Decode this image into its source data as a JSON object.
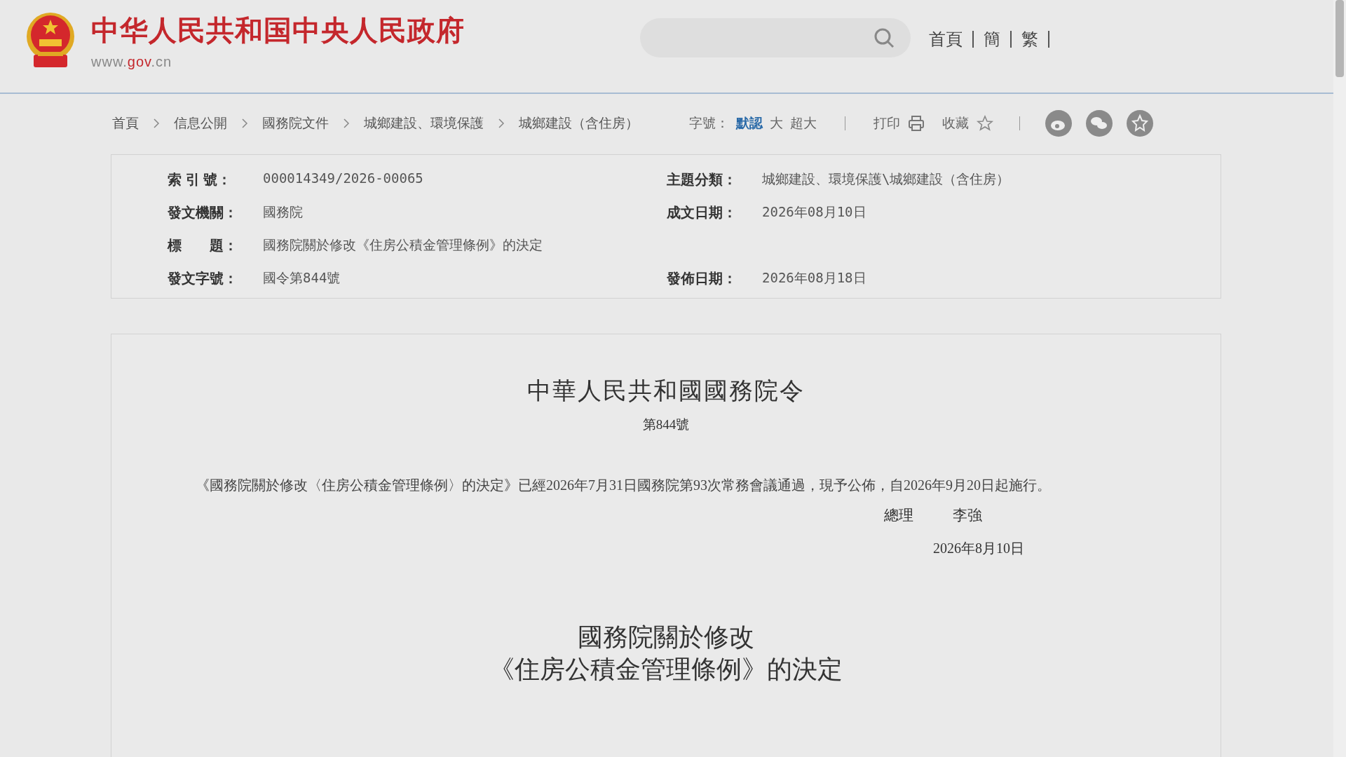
{
  "header": {
    "title": "中华人民共和国中央人民政府",
    "url_prefix": "www.",
    "url_domain": "gov",
    "url_suffix": ".cn",
    "nav": [
      {
        "label": "首頁"
      },
      {
        "label": "簡"
      },
      {
        "label": "繁"
      }
    ]
  },
  "breadcrumb": [
    {
      "label": "首頁",
      "current": false
    },
    {
      "label": "信息公開",
      "current": false
    },
    {
      "label": "國務院文件",
      "current": false
    },
    {
      "label": "城鄉建設、環境保護",
      "current": false
    },
    {
      "label": "城鄉建設（含住房）",
      "current": false
    }
  ],
  "font_size": {
    "label": "字號：",
    "options": [
      {
        "label": "默認",
        "selected": true
      },
      {
        "label": "大",
        "selected": false
      },
      {
        "label": "超大",
        "selected": false
      }
    ]
  },
  "tools": [
    {
      "label": "打印",
      "kind": "print"
    },
    {
      "label": "收藏",
      "kind": "favorite"
    }
  ],
  "info": {
    "rows": [
      {
        "cells": [
          {
            "label": "索 引 號：",
            "value": "000014349/2026-00065"
          },
          {
            "label": "主題分類：",
            "value": "城鄉建設、環境保護\\城鄉建設（含住房）"
          }
        ]
      },
      {
        "cells": [
          {
            "label": "發文機關：",
            "value": "國務院"
          },
          {
            "label": "成文日期：",
            "value": "2026年08月10日"
          }
        ]
      },
      {
        "cells": [
          {
            "label": "標　　題：",
            "value": "國務院關於修改《住房公積金管理條例》的決定"
          }
        ]
      },
      {
        "cells": [
          {
            "label": "發文字號：",
            "value": "國令第844號"
          },
          {
            "label": "發佈日期：",
            "value": "2026年08月18日"
          }
        ]
      }
    ]
  },
  "document": {
    "heading": "中華人民共和國國務院令",
    "number": "第844號",
    "body": "《國務院關於修改〈住房公積金管理條例〉的決定》已經2026年7月31日國務院第93次常務會議通過，現予公佈，自2026年9月20日起施行。",
    "signature": {
      "title": "總理",
      "name": "李強"
    },
    "date": "2026年8月10日",
    "subtitle": [
      "國務院關於修改",
      "《住房公積金管理條例》的決定"
    ]
  }
}
